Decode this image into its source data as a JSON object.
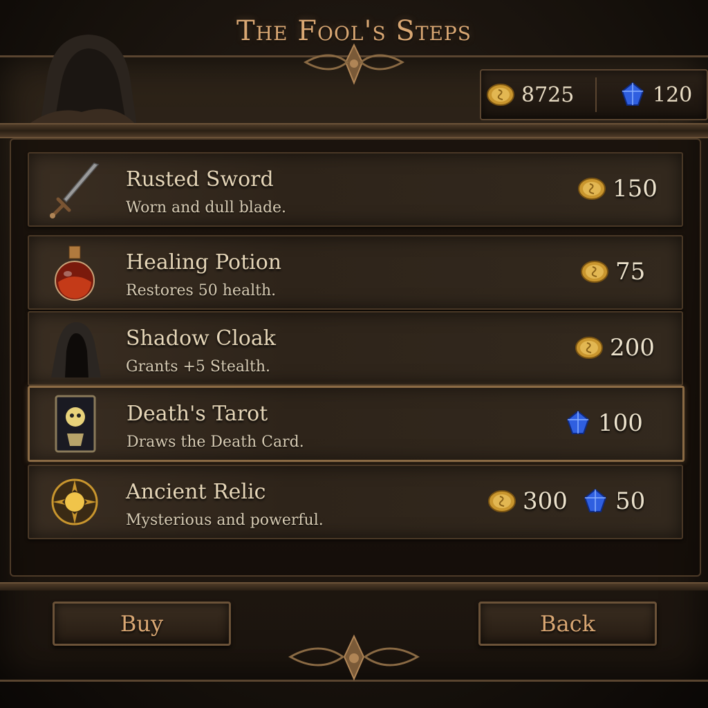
{
  "title": "The Fool's Steps",
  "currency": {
    "gold": "8725",
    "gems": "120"
  },
  "items": [
    {
      "name": "Rusted Sword",
      "desc": "Worn and dull blade.",
      "gold": "150",
      "icon": "sword-icon"
    },
    {
      "name": "Healing Potion",
      "desc": "Restores 50 health.",
      "gold": "75",
      "icon": "potion-icon"
    },
    {
      "name": "Shadow Cloak",
      "desc": "Grants +5 Stealth.",
      "gold": "200",
      "icon": "cloak-icon"
    },
    {
      "name": "Death's Tarot",
      "desc": "Draws the Death Card.",
      "gems": "100",
      "icon": "tarot-card-icon"
    },
    {
      "name": "Ancient Relic",
      "desc": "Mysterious and powerful.",
      "gold": "300",
      "gems": "50",
      "icon": "relic-icon"
    }
  ],
  "buttons": {
    "buy": "Buy",
    "back": "Back"
  },
  "colors": {
    "accent": "#d9a773",
    "gold": "#d4a437",
    "gem": "#2f5fe0",
    "panel": "#2e241a",
    "border": "#6b5238"
  }
}
